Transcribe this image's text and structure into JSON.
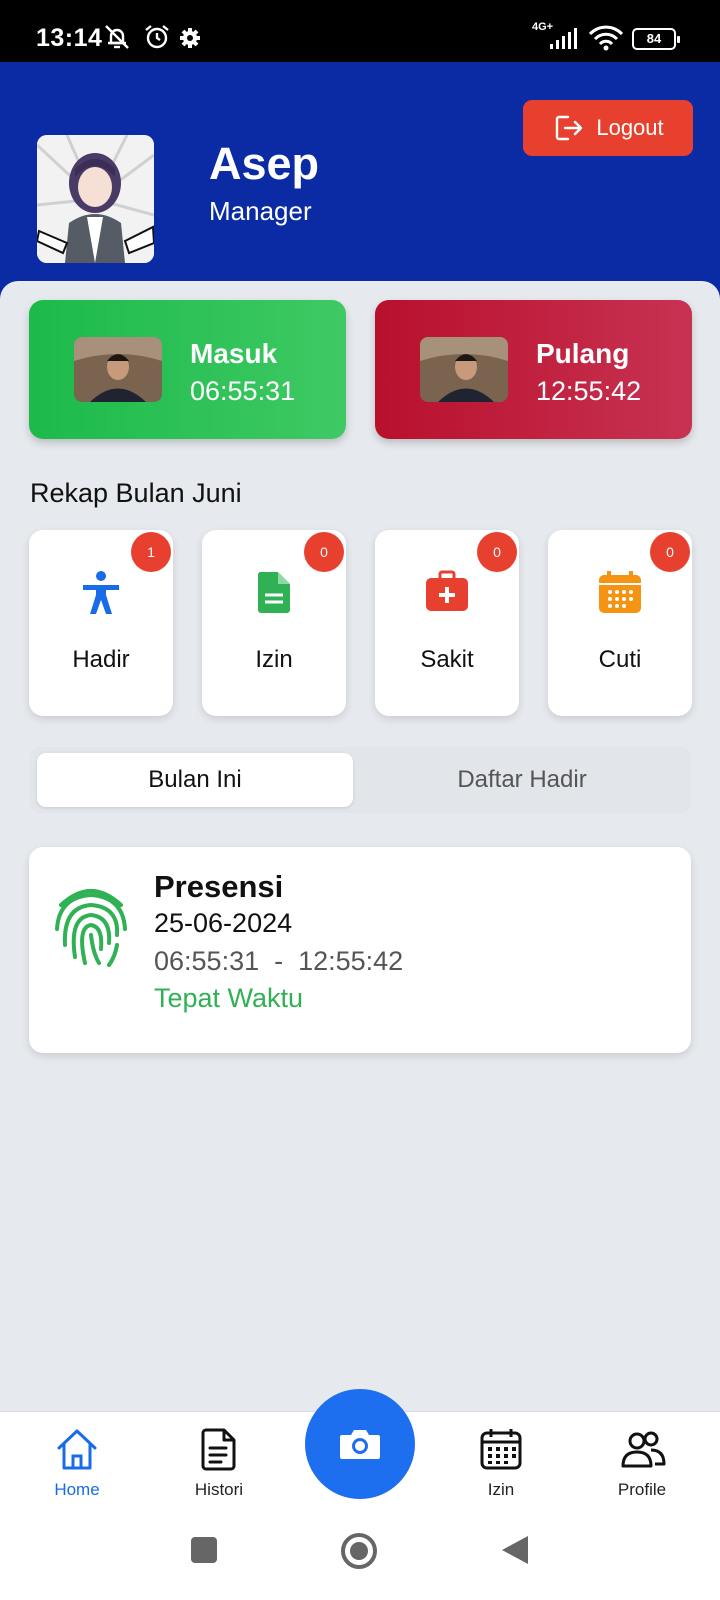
{
  "status_bar": {
    "time": "13:14",
    "network": "4G+",
    "battery": "84"
  },
  "header": {
    "user_name": "Asep",
    "user_role": "Manager",
    "logout_label": "Logout"
  },
  "attendance": {
    "check_in": {
      "label": "Masuk",
      "time": "06:55:31"
    },
    "check_out": {
      "label": "Pulang",
      "time": "12:55:42"
    }
  },
  "recap": {
    "title": "Rekap Bulan Juni",
    "items": [
      {
        "label": "Hadir",
        "count": "1",
        "icon": "accessibility-person-icon",
        "color": "#1a6be8"
      },
      {
        "label": "Izin",
        "count": "0",
        "icon": "document-icon",
        "color": "#2fb154"
      },
      {
        "label": "Sakit",
        "count": "0",
        "icon": "medical-kit-icon",
        "color": "#e8402f"
      },
      {
        "label": "Cuti",
        "count": "0",
        "icon": "calendar-icon",
        "color": "#f59312"
      }
    ]
  },
  "tabs": [
    {
      "label": "Bulan Ini",
      "active": true
    },
    {
      "label": "Daftar Hadir",
      "active": false
    }
  ],
  "presence_list": [
    {
      "title": "Presensi",
      "date": "25-06-2024",
      "time_range": "06:55:31  -  12:55:42",
      "status": "Tepat Waktu"
    }
  ],
  "bottom_nav": {
    "items": [
      {
        "label": "Home",
        "icon": "home-icon",
        "active": true
      },
      {
        "label": "Histori",
        "icon": "document-list-icon",
        "active": false
      },
      {
        "label": "Izin",
        "icon": "calendar-icon",
        "active": false
      },
      {
        "label": "Profile",
        "icon": "users-icon",
        "active": false
      }
    ],
    "center_action_icon": "camera-icon"
  },
  "colors": {
    "header_bg": "#0a2ba3",
    "accent_blue": "#1d6ff0",
    "check_in_green": "#1cba4a",
    "check_out_red": "#b8102c",
    "badge_red": "#e8402f",
    "status_green": "#2fb154"
  }
}
